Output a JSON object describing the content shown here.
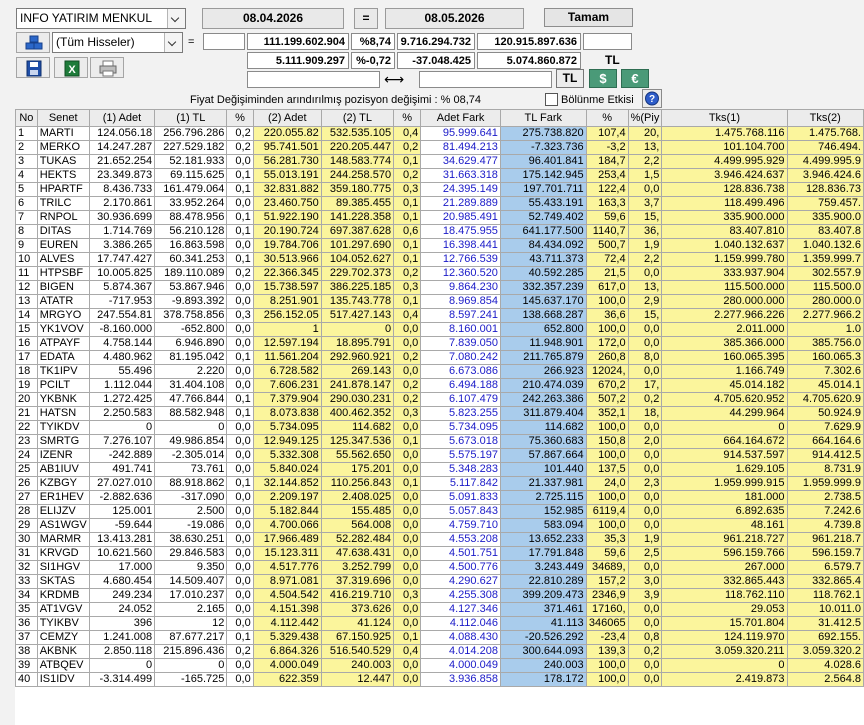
{
  "top": {
    "broker": "INFO YATIRIM MENKUL",
    "filter": "(Tüm Hisseler)",
    "date_from": "08.04.2026",
    "equals": "=",
    "date_to": "08.05.2026",
    "ok_label": "Tamam",
    "eq_sign": "=",
    "r1_tl": "111.199.602.904",
    "r1_pct": "%8,74",
    "r1_diff": "9.716.294.732",
    "r1_total": "120.915.897.636",
    "r2_tl": "5.111.909.297",
    "r2_pct": "%-0,72",
    "r2_diff": "-37.048.425",
    "r2_total": "5.074.860.872",
    "r2_unit": "TL",
    "arrows": "⟷",
    "btn_tl": "TL",
    "btn_usd": "$",
    "btn_eur": "€",
    "fiyat_text": "Fiyat Değişiminden arındırılmış pozisyon değişimi : % 08,74",
    "bolunme": "Bölünme Etkisi",
    "help": "?"
  },
  "colors": {
    "yellow": "#fbf59c",
    "blue_col": "#a9ccec",
    "blue_text": "#1a1ac8",
    "currency_btn": "#4a9a78"
  },
  "icons": [
    "stack-icon",
    "save-icon",
    "excel-icon",
    "printer-icon",
    "chevron-down-icon",
    "help-icon"
  ],
  "table": {
    "headers": [
      "No",
      "Senet",
      "(1) Adet",
      "(1) TL",
      "%",
      "(2) Adet",
      "(2) TL",
      "%",
      "Adet Fark",
      "TL Fark",
      "%",
      "%(Piy",
      "Tks(1)",
      "Tks(2)"
    ],
    "rows": [
      [
        "1",
        "MARTI",
        "124.056.18",
        "256.796.286",
        "0,2",
        "220.055.82",
        "532.535.105",
        "0,4",
        "95.999.641",
        "275.738.820",
        "107,4",
        "20,",
        "1.475.768.116",
        "1.475.768."
      ],
      [
        "2",
        "MERKO",
        "14.247.287",
        "227.529.182",
        "0,2",
        "95.741.501",
        "220.205.447",
        "0,2",
        "81.494.213",
        "-7.323.736",
        "-3,2",
        "13,",
        "101.104.700",
        "746.494."
      ],
      [
        "3",
        "TUKAS",
        "21.652.254",
        "52.181.933",
        "0,0",
        "56.281.730",
        "148.583.774",
        "0,1",
        "34.629.477",
        "96.401.841",
        "184,7",
        "2,2",
        "4.499.995.929",
        "4.499.995.9"
      ],
      [
        "4",
        "HEKTS",
        "23.349.873",
        "69.115.625",
        "0,1",
        "55.013.191",
        "244.258.570",
        "0,2",
        "31.663.318",
        "175.142.945",
        "253,4",
        "1,5",
        "3.946.424.637",
        "3.946.424.6"
      ],
      [
        "5",
        "HPARTF",
        "8.436.733",
        "161.479.064",
        "0,1",
        "32.831.882",
        "359.180.775",
        "0,3",
        "24.395.149",
        "197.701.711",
        "122,4",
        "0,0",
        "128.836.738",
        "128.836.73"
      ],
      [
        "6",
        "TRILC",
        "2.170.861",
        "33.952.264",
        "0,0",
        "23.460.750",
        "89.385.455",
        "0,1",
        "21.289.889",
        "55.433.191",
        "163,3",
        "3,7",
        "118.499.496",
        "759.457."
      ],
      [
        "7",
        "RNPOL",
        "30.936.699",
        "88.478.956",
        "0,1",
        "51.922.190",
        "141.228.358",
        "0,1",
        "20.985.491",
        "52.749.402",
        "59,6",
        "15,",
        "335.900.000",
        "335.900.0"
      ],
      [
        "8",
        "DITAS",
        "1.714.769",
        "56.210.128",
        "0,1",
        "20.190.724",
        "697.387.628",
        "0,6",
        "18.475.955",
        "641.177.500",
        "1140,7",
        "36,",
        "83.407.810",
        "83.407.8"
      ],
      [
        "9",
        "EUREN",
        "3.386.265",
        "16.863.598",
        "0,0",
        "19.784.706",
        "101.297.690",
        "0,1",
        "16.398.441",
        "84.434.092",
        "500,7",
        "1,9",
        "1.040.132.637",
        "1.040.132.6"
      ],
      [
        "10",
        "ALVES",
        "17.747.427",
        "60.341.253",
        "0,1",
        "30.513.966",
        "104.052.627",
        "0,1",
        "12.766.539",
        "43.711.373",
        "72,4",
        "2,2",
        "1.159.999.780",
        "1.359.999.7"
      ],
      [
        "11",
        "HTPSBF",
        "10.005.825",
        "189.110.089",
        "0,2",
        "22.366.345",
        "229.702.373",
        "0,2",
        "12.360.520",
        "40.592.285",
        "21,5",
        "0,0",
        "333.937.904",
        "302.557.9"
      ],
      [
        "12",
        "BIGEN",
        "5.874.367",
        "53.867.946",
        "0,0",
        "15.738.597",
        "386.225.185",
        "0,3",
        "9.864.230",
        "332.357.239",
        "617,0",
        "13,",
        "115.500.000",
        "115.500.0"
      ],
      [
        "13",
        "ATATR",
        "-717.953",
        "-9.893.392",
        "0,0",
        "8.251.901",
        "135.743.778",
        "0,1",
        "8.969.854",
        "145.637.170",
        "100,0",
        "2,9",
        "280.000.000",
        "280.000.0"
      ],
      [
        "14",
        "MRGYO",
        "247.554.81",
        "378.758.856",
        "0,3",
        "256.152.05",
        "517.427.143",
        "0,4",
        "8.597.241",
        "138.668.287",
        "36,6",
        "15,",
        "2.277.966.226",
        "2.277.966.2"
      ],
      [
        "15",
        "YK1VOV",
        "-8.160.000",
        "-652.800",
        "0,0",
        "1",
        "0",
        "0,0",
        "8.160.001",
        "652.800",
        "100,0",
        "0,0",
        "2.011.000",
        "1.0"
      ],
      [
        "16",
        "ATPAYF",
        "4.758.144",
        "6.946.890",
        "0,0",
        "12.597.194",
        "18.895.791",
        "0,0",
        "7.839.050",
        "11.948.901",
        "172,0",
        "0,0",
        "385.366.000",
        "385.756.0"
      ],
      [
        "17",
        "EDATA",
        "4.480.962",
        "81.195.042",
        "0,1",
        "11.561.204",
        "292.960.921",
        "0,2",
        "7.080.242",
        "211.765.879",
        "260,8",
        "8,0",
        "160.065.395",
        "160.065.3"
      ],
      [
        "18",
        "TK1IPV",
        "55.496",
        "2.220",
        "0,0",
        "6.728.582",
        "269.143",
        "0,0",
        "6.673.086",
        "266.923",
        "12024,",
        "0,0",
        "1.166.749",
        "7.302.6"
      ],
      [
        "19",
        "PCILT",
        "1.112.044",
        "31.404.108",
        "0,0",
        "7.606.231",
        "241.878.147",
        "0,2",
        "6.494.188",
        "210.474.039",
        "670,2",
        "17,",
        "45.014.182",
        "45.014.1"
      ],
      [
        "20",
        "YKBNK",
        "1.272.425",
        "47.766.844",
        "0,1",
        "7.379.904",
        "290.030.231",
        "0,2",
        "6.107.479",
        "242.263.386",
        "507,2",
        "0,2",
        "4.705.620.952",
        "4.705.620.9"
      ],
      [
        "21",
        "HATSN",
        "2.250.583",
        "88.582.948",
        "0,1",
        "8.073.838",
        "400.462.352",
        "0,3",
        "5.823.255",
        "311.879.404",
        "352,1",
        "18,",
        "44.299.964",
        "50.924.9"
      ],
      [
        "22",
        "TYIKDV",
        "0",
        "0",
        "0,0",
        "5.734.095",
        "114.682",
        "0,0",
        "5.734.095",
        "114.682",
        "100,0",
        "0,0",
        "0",
        "7.629.9"
      ],
      [
        "23",
        "SMRTG",
        "7.276.107",
        "49.986.854",
        "0,0",
        "12.949.125",
        "125.347.536",
        "0,1",
        "5.673.018",
        "75.360.683",
        "150,8",
        "2,0",
        "664.164.672",
        "664.164.6"
      ],
      [
        "24",
        "IZENR",
        "-242.889",
        "-2.305.014",
        "0,0",
        "5.332.308",
        "55.562.650",
        "0,0",
        "5.575.197",
        "57.867.664",
        "100,0",
        "0,0",
        "914.537.597",
        "914.412.5"
      ],
      [
        "25",
        "AB1IUV",
        "491.741",
        "73.761",
        "0,0",
        "5.840.024",
        "175.201",
        "0,0",
        "5.348.283",
        "101.440",
        "137,5",
        "0,0",
        "1.629.105",
        "8.731.9"
      ],
      [
        "26",
        "KZBGY",
        "27.027.010",
        "88.918.862",
        "0,1",
        "32.144.852",
        "110.256.843",
        "0,1",
        "5.117.842",
        "21.337.981",
        "24,0",
        "2,3",
        "1.959.999.915",
        "1.959.999.9"
      ],
      [
        "27",
        "ER1HEV",
        "-2.882.636",
        "-317.090",
        "0,0",
        "2.209.197",
        "2.408.025",
        "0,0",
        "5.091.833",
        "2.725.115",
        "100,0",
        "0,0",
        "181.000",
        "2.738.5"
      ],
      [
        "28",
        "ELIJZV",
        "125.001",
        "2.500",
        "0,0",
        "5.182.844",
        "155.485",
        "0,0",
        "5.057.843",
        "152.985",
        "6119,4",
        "0,0",
        "6.892.635",
        "7.242.6"
      ],
      [
        "29",
        "AS1WGV",
        "-59.644",
        "-19.086",
        "0,0",
        "4.700.066",
        "564.008",
        "0,0",
        "4.759.710",
        "583.094",
        "100,0",
        "0,0",
        "48.161",
        "4.739.8"
      ],
      [
        "30",
        "MARMR",
        "13.413.281",
        "38.630.251",
        "0,0",
        "17.966.489",
        "52.282.484",
        "0,0",
        "4.553.208",
        "13.652.233",
        "35,3",
        "1,9",
        "961.218.727",
        "961.218.7"
      ],
      [
        "31",
        "KRVGD",
        "10.621.560",
        "29.846.583",
        "0,0",
        "15.123.311",
        "47.638.431",
        "0,0",
        "4.501.751",
        "17.791.848",
        "59,6",
        "2,5",
        "596.159.766",
        "596.159.7"
      ],
      [
        "32",
        "SI1HGV",
        "17.000",
        "9.350",
        "0,0",
        "4.517.776",
        "3.252.799",
        "0,0",
        "4.500.776",
        "3.243.449",
        "34689,",
        "0,0",
        "267.000",
        "6.579.7"
      ],
      [
        "33",
        "SKTAS",
        "4.680.454",
        "14.509.407",
        "0,0",
        "8.971.081",
        "37.319.696",
        "0,0",
        "4.290.627",
        "22.810.289",
        "157,2",
        "3,0",
        "332.865.443",
        "332.865.4"
      ],
      [
        "34",
        "KRDMB",
        "249.234",
        "17.010.237",
        "0,0",
        "4.504.542",
        "416.219.710",
        "0,3",
        "4.255.308",
        "399.209.473",
        "2346,9",
        "3,9",
        "118.762.110",
        "118.762.1"
      ],
      [
        "35",
        "AT1VGV",
        "24.052",
        "2.165",
        "0,0",
        "4.151.398",
        "373.626",
        "0,0",
        "4.127.346",
        "371.461",
        "17160,",
        "0,0",
        "29.053",
        "10.011.0"
      ],
      [
        "36",
        "TYIKBV",
        "396",
        "12",
        "0,0",
        "4.112.442",
        "41.124",
        "0,0",
        "4.112.046",
        "41.113",
        "346065",
        "0,0",
        "15.701.804",
        "31.412.5"
      ],
      [
        "37",
        "CEMZY",
        "1.241.008",
        "87.677.217",
        "0,1",
        "5.329.438",
        "67.150.925",
        "0,1",
        "4.088.430",
        "-20.526.292",
        "-23,4",
        "0,8",
        "124.119.970",
        "692.155."
      ],
      [
        "38",
        "AKBNK",
        "2.850.118",
        "215.896.436",
        "0,2",
        "6.864.326",
        "516.540.529",
        "0,4",
        "4.014.208",
        "300.644.093",
        "139,3",
        "0,2",
        "3.059.320.211",
        "3.059.320.2"
      ],
      [
        "39",
        "ATBQEV",
        "0",
        "0",
        "0,0",
        "4.000.049",
        "240.003",
        "0,0",
        "4.000.049",
        "240.003",
        "100,0",
        "0,0",
        "0",
        "4.028.6"
      ],
      [
        "40",
        "IS1IDV",
        "-3.314.499",
        "-165.725",
        "0,0",
        "622.359",
        "12.447",
        "0,0",
        "3.936.858",
        "178.172",
        "100,0",
        "0,0",
        "2.419.873",
        "2.564.8"
      ]
    ]
  }
}
